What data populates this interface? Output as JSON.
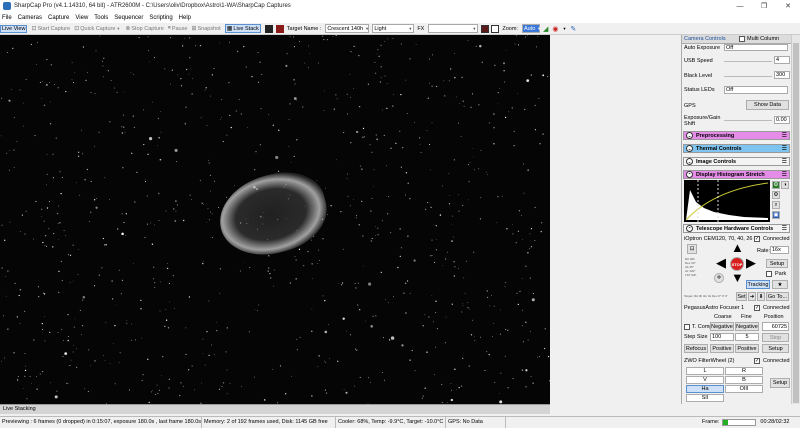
{
  "window": {
    "title": "SharpCap Pro (v4.1.14310, 64 bit) - ATR2600M - C:\\Users\\oliv\\Dropbox\\Astro\\1-WA\\SharpCap Captures",
    "minimize": "—",
    "maximize": "❐",
    "close": "✕"
  },
  "menu": [
    "File",
    "Cameras",
    "Capture",
    "View",
    "Tools",
    "Sequencer",
    "Scripting",
    "Help"
  ],
  "toolbar": {
    "live_view": "Live View",
    "start_capture": "Start Capture",
    "quick_capture": "Quick Capture",
    "stop_capture": "Stop Capture",
    "pause": "Pause",
    "snapshot": "Snapshot",
    "live_stack": "Live Stack",
    "target_label": "Target Name :",
    "target_value": "Crescent 140h",
    "light_value": "Light",
    "fx_label": "FX",
    "fx_value": "",
    "zoom_label": "Zoom:",
    "zoom_value": "Auto"
  },
  "live_stacking_tab": "Live Stacking",
  "status": {
    "preview": "Previewing : 6 frames (0 dropped) in 0:15:07, exposure 180.0s , last frame 180.0s",
    "memory": "Memory: 2 of 192 frames used, Disk: 1145 GB free",
    "cooler": "Cooler: 68%, Temp: -9.9°C, Target: -10.0°C",
    "gps": "GPS: No Data",
    "frame_label": "Frame:",
    "frame_progress": 0.15,
    "time": "00:28/02:32"
  },
  "panel": {
    "camera_controls": "Camera Controls",
    "multi_column": "Multi Column",
    "auto_exposure_label": "Auto Exposure",
    "auto_exposure_value": "Off",
    "usb_speed_label": "USB Speed",
    "usb_speed_value": "4",
    "black_level_label": "Black Level",
    "black_level_value": "300",
    "status_leds_label": "Status LEDs",
    "status_leds_value": "Off",
    "gps_label": "GPS",
    "show_data": "Show Data",
    "exposure_gain_label": "Exposure/Gain Shift",
    "exposure_gain_value": "0.00",
    "sections": {
      "preprocessing": "Preprocessing",
      "thermal": "Thermal Controls",
      "image": "Image Controls",
      "histogram": "Display Histogram Stretch",
      "telescope": "Telescope Hardware Controls"
    },
    "colors": {
      "preprocessing": "#e58be8",
      "thermal": "#7fc4f0",
      "histogram": "#e58be8"
    },
    "mount_name": "iOptron CEM120, 70, 40, 26",
    "connected": "Connected",
    "rate_label": "Rate:",
    "rate_value": "16x",
    "setup": "Setup",
    "stop": "STOP",
    "park": "Park",
    "tracking": "Tracking",
    "set": "Set",
    "goto": "Go To...",
    "mount_info": "Target: RA 0h 0m 0s  Dec 0° 0' 0\"",
    "focuser_name": "PegasusAstro Focuser 1",
    "coarse": "Coarse",
    "fine": "Fine",
    "position": "Position",
    "t_comp": "T. Comp",
    "negative": "Negative",
    "position_value": "60725",
    "step_size_label": "Step Size",
    "step_coarse": "100",
    "step_fine": "5",
    "focuser_stop": "Stop",
    "refocus": "Refocus",
    "positive": "Positive",
    "filterwheel_name": "ZWO FilterWheel (2)",
    "filters": [
      "L",
      "R",
      "V",
      "B",
      "Ha",
      "OIII",
      "SII"
    ]
  }
}
